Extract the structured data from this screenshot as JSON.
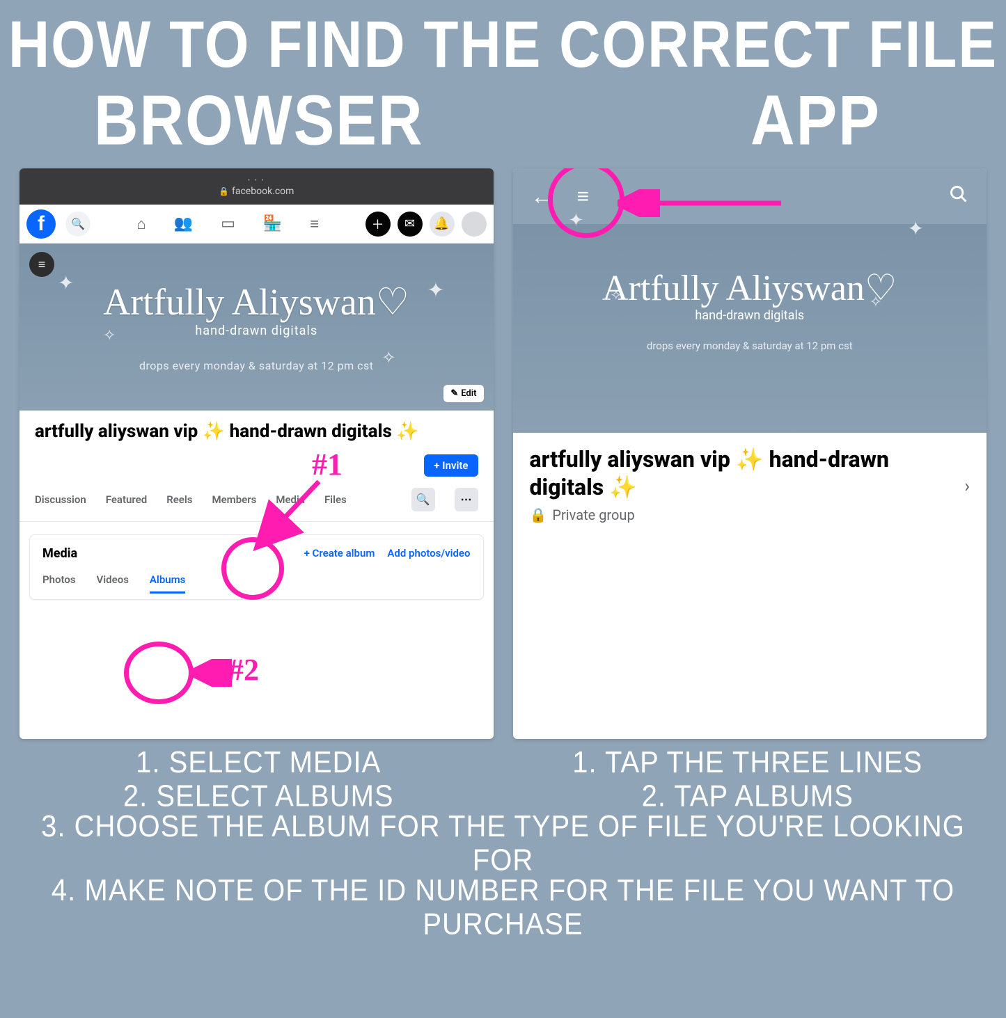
{
  "title": "HOW TO FIND THE CORRECT FILE",
  "labels": {
    "browser": "BROWSER",
    "app": "APP"
  },
  "browser": {
    "url": "facebook.com",
    "group_title": "artfully aliyswan vip ✨ hand-drawn digitals ✨",
    "edit_label": "Edit",
    "invite_label": "+ Invite",
    "cover": {
      "script": "Artfully Aliyswan♡",
      "sub": "hand-drawn digitals",
      "drops": "drops every monday & saturday at 12 pm cst"
    },
    "tabs": {
      "t0": "Discussion",
      "t1": "Featured",
      "t2": "Reels",
      "t3": "Members",
      "t4": "Media",
      "t5": "Files"
    },
    "media_section": {
      "title": "Media",
      "create_album": "+  Create album",
      "add_photos": "Add photos/video",
      "subtabs": {
        "s0": "Photos",
        "s1": "Videos",
        "s2": "Albums"
      }
    },
    "annotations": {
      "a1": "#1",
      "a2": "#2"
    }
  },
  "app": {
    "title": "artfully aliyswan vip ✨ hand-drawn digitals ✨",
    "privacy": "Private group",
    "cover": {
      "script": "Artfully Aliyswan♡",
      "sub": "hand-drawn digitals",
      "drops": "drops every monday & saturday at 12 pm cst"
    }
  },
  "instructions": {
    "browser": {
      "l1": "1. SELECT MEDIA",
      "l2": "2. SELECT ALBUMS"
    },
    "app": {
      "l1": "1. TAP THE THREE LINES",
      "l2": "2. TAP ALBUMS"
    },
    "l3": "3. CHOOSE THE ALBUM FOR THE TYPE OF FILE YOU'RE LOOKING FOR",
    "l4": "4. MAKE NOTE OF THE ID NUMBER FOR THE FILE YOU WANT TO PURCHASE"
  }
}
